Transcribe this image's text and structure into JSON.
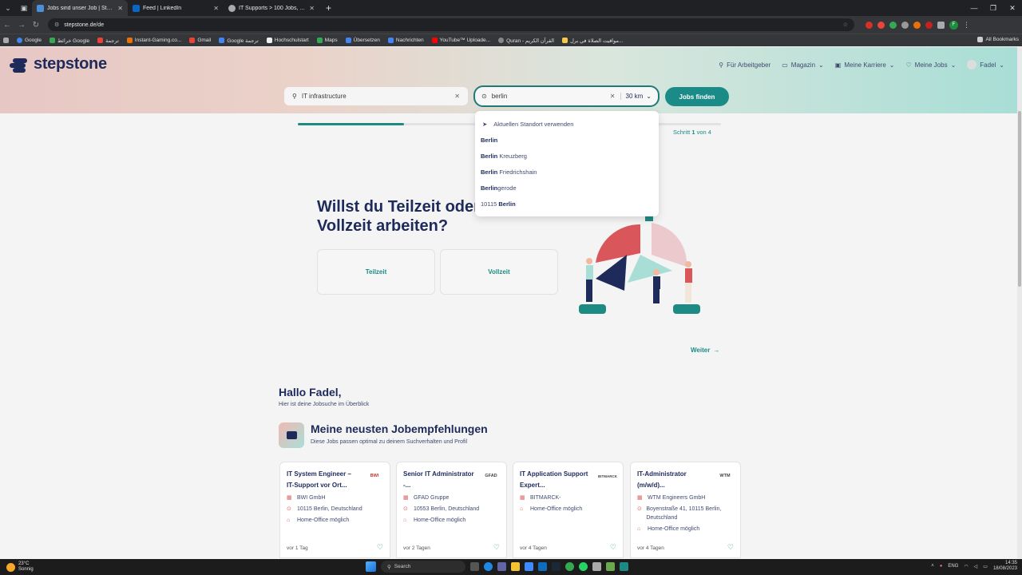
{
  "browser": {
    "tabs": [
      {
        "title": "Jobs sind unser Job | Stepstone",
        "active": true,
        "color": "#4a90d9"
      },
      {
        "title": "Feed | LinkedIn",
        "active": false,
        "color": "#0a66c2"
      },
      {
        "title": "IT Supports > 100 Jobs, Arbeit",
        "active": false,
        "color": "#aaaaaa"
      }
    ],
    "url": "stepstone.de/de",
    "bookmarks": [
      "Google",
      "خرائط Google",
      "ترجمة",
      "Instant-Gaming.co...",
      "Gmail",
      "Google ترجمة",
      "Hochschulstart",
      "Maps",
      "Übersetzen",
      "Nachrichten",
      "YouTube™ Uploade...",
      "Quran - القرآن الكريم",
      "مواقيت الصلاة في برل..."
    ],
    "all_bookmarks": "All Bookmarks",
    "profile_initial": "F"
  },
  "site": {
    "logo": "stepstone",
    "nav": [
      "Für Arbeitgeber",
      "Magazin",
      "Meine Karriere",
      "Meine Jobs",
      "Fadel"
    ],
    "search": {
      "what_value": "IT infrastructure",
      "where_value": "berlin",
      "radius": "30 km",
      "button": "Jobs finden"
    },
    "dropdown": {
      "use_location": "Aktuellen Standort verwenden",
      "suggestions": [
        {
          "bold": "Berlin",
          "rest": ""
        },
        {
          "bold": "Berlin",
          "rest": " Kreuzberg"
        },
        {
          "bold": "Berlin",
          "rest": " Friedrichshain"
        },
        {
          "bold": "Berlin",
          "rest": "gerode"
        },
        {
          "pre": "10115 ",
          "bold": "Berlin",
          "rest": ""
        }
      ]
    },
    "wizard": {
      "step_label": "Schritt",
      "step_num": "1",
      "step_of": "von 4",
      "progress": 0.25,
      "question": "Willst du Teilzeit oder Vollzeit arbeiten?",
      "options": [
        "Teilzeit",
        "Vollzeit"
      ],
      "next": "Weiter"
    },
    "greeting": {
      "title": "Hallo Fadel,",
      "subtitle": "Hier ist deine Jobsuche im Überblick"
    },
    "recommendations": {
      "title": "Meine neusten Jobempfehlungen",
      "subtitle": "Diese Jobs passen optimal zu deinem Suchverhalten und Profil",
      "cards": [
        {
          "title": "IT System Engineer – IT-Support vor Ort...",
          "logo": "BWI",
          "company": "BWI GmbH",
          "location": "10115 Berlin, Deutschland",
          "remote": "Home-Office möglich",
          "age": "vor 1 Tag"
        },
        {
          "title": "Senior IT Administrator -...",
          "logo": "GFAD",
          "company": "GFAD Gruppe",
          "location": "10553 Berlin, Deutschland",
          "remote": "Home-Office möglich",
          "age": "vor 2 Tagen"
        },
        {
          "title": "IT Application Support Expert...",
          "logo": "BITMARCK",
          "company": "BITMARCK-",
          "location": "",
          "remote": "Home-Office möglich",
          "age": "vor 4 Tagen"
        },
        {
          "title": "IT-Administrator (m/w/d)...",
          "logo": "WTM",
          "company": "WTM Engineers GmbH",
          "location": "Boyenstraße 41, 10115 Berlin, Deutschland",
          "remote": "Home-Office möglich",
          "age": "vor 4 Tagen"
        }
      ]
    }
  },
  "taskbar": {
    "weather_temp": "23°C",
    "weather_desc": "Sonnig",
    "search": "Search",
    "lang": "ENG",
    "time": "14:35",
    "date": "18/08/2023"
  },
  "colors": {
    "brand_navy": "#1d2a5a",
    "brand_teal": "#1b8b88"
  }
}
